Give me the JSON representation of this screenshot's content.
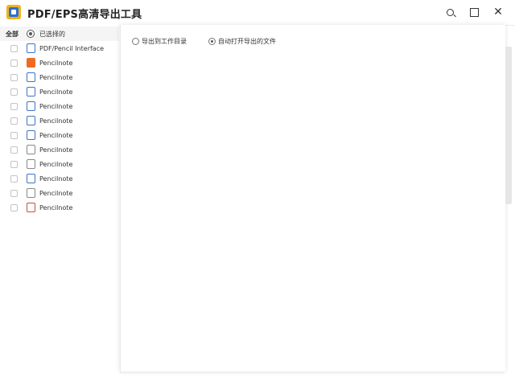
{
  "app": {
    "title": "PDF/EPS高清导出工具"
  },
  "window_controls": {
    "search_icon": "search-icon",
    "maximize_icon": "maximize-icon",
    "close_icon": "close-icon",
    "close_glyph": "✕"
  },
  "sidebar": {
    "header": {
      "label": "全部",
      "item_label": "已选择的"
    },
    "items": [
      {
        "label": "PDF/Pencil Interface",
        "icon": "document-icon"
      },
      {
        "label": "Pencilnote",
        "icon": "orange-file-icon"
      },
      {
        "label": "Pencilnote",
        "icon": "file-icon"
      },
      {
        "label": "Pencilnote",
        "icon": "file-icon"
      },
      {
        "label": "Pencilnote",
        "icon": "file-icon"
      },
      {
        "label": "Pencilnote",
        "icon": "file-icon"
      },
      {
        "label": "Pencilnote",
        "icon": "file-icon"
      },
      {
        "label": "Pencilnote",
        "icon": "file-icon"
      },
      {
        "label": "Pencilnote",
        "icon": "file-icon"
      },
      {
        "label": "Pencilnote",
        "icon": "file-icon"
      },
      {
        "label": "Pencilnote",
        "icon": "file-icon"
      },
      {
        "label": "Pencilnote",
        "icon": "file-icon"
      }
    ]
  },
  "main": {
    "options": [
      {
        "label": "导出到工作目录",
        "checked": false
      },
      {
        "label": "自动打开导出的文件",
        "checked": true
      }
    ]
  }
}
